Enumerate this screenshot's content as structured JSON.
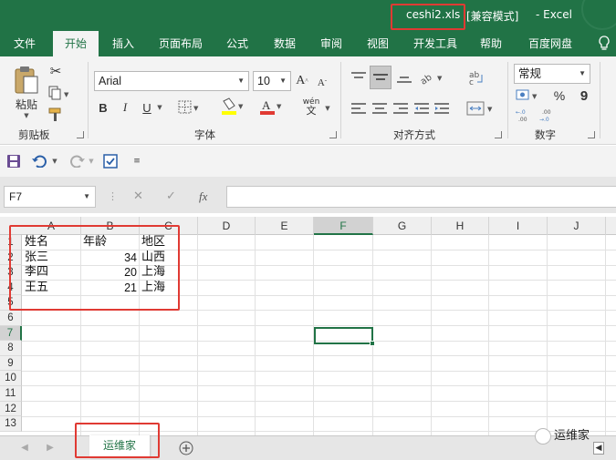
{
  "title_bar": {
    "file_name": "ceshi2.xls",
    "mode": "[兼容模式]",
    "separator": "-",
    "app_name": "Excel"
  },
  "ribbon_tabs": [
    "文件",
    "开始",
    "插入",
    "页面布局",
    "公式",
    "数据",
    "审阅",
    "视图",
    "开发工具",
    "帮助",
    "百度网盘"
  ],
  "active_tab": "开始",
  "help_icon": "lightbulb-icon",
  "clipboard": {
    "paste_label": "粘贴",
    "group_label": "剪贴板"
  },
  "font": {
    "name": "Arial",
    "size": "10",
    "bold": "B",
    "italic": "I",
    "underline": "U",
    "phonetic": "wén",
    "group_label": "字体"
  },
  "alignment": {
    "group_label": "对齐方式"
  },
  "number": {
    "format": "常规",
    "percent": "%",
    "comma": "9",
    "group_label": "数字"
  },
  "name_box": "F7",
  "formula": "",
  "columns": [
    "A",
    "B",
    "C",
    "D",
    "E",
    "F",
    "G",
    "H",
    "I",
    "J"
  ],
  "rows": [
    "1",
    "2",
    "3",
    "4",
    "5",
    "6",
    "7",
    "8",
    "9",
    "10",
    "11",
    "12",
    "13"
  ],
  "selected_cell": {
    "column": "F",
    "row": "7"
  },
  "cells": {
    "A1": "姓名",
    "B1": "年龄",
    "C1": "地区",
    "A2": "张三",
    "B2": "34",
    "C2": "山西",
    "A3": "李四",
    "B3": "20",
    "C3": "上海",
    "A4": "王五",
    "B4": "21",
    "C4": "上海"
  },
  "sheet_tab": "运维家",
  "watermark": "运维家",
  "colors": {
    "excel_green": "#217346",
    "highlight_red": "#e03a33"
  }
}
